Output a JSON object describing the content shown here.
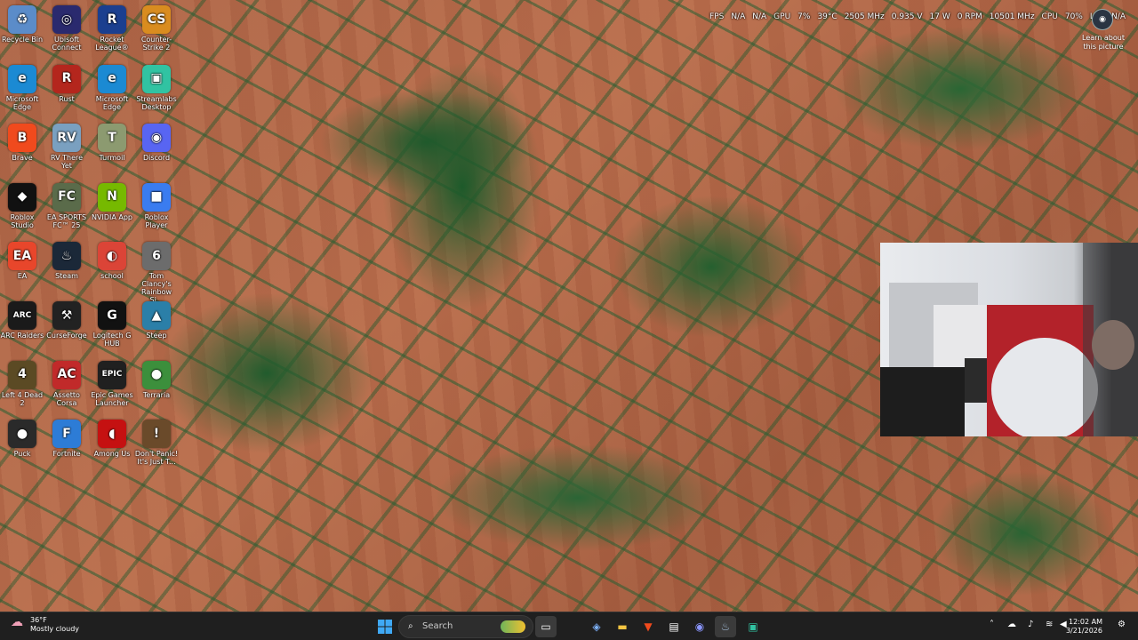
{
  "overlay": {
    "fps_label": "FPS",
    "fps_value": "N/A",
    "fps_value2": "N/A",
    "gpu_label": "GPU",
    "gpu_load": "7%",
    "gpu_temp": "39°C",
    "gpu_clock": "2505 MHz",
    "gpu_voltage": "0.935 V",
    "gpu_power": "17 W",
    "gpu_fan": "0 RPM",
    "gpu_mem_clock": "10501 MHz",
    "cpu_label": "CPU",
    "cpu_load": "70%",
    "lat_label": "LAT",
    "lat_value": "N/A"
  },
  "learn_more": "Learn about this picture",
  "desktop_icons": [
    {
      "label": "Recycle Bin",
      "icon": "recycle-bin-icon",
      "glyph": "♻",
      "color": "#5b8cc9"
    },
    {
      "label": "Ubisoft Connect",
      "icon": "ubisoft-icon",
      "glyph": "◎",
      "color": "#2a2a6e"
    },
    {
      "label": "Rocket League®",
      "icon": "rocket-league-icon",
      "glyph": "R",
      "color": "#1b3f8f"
    },
    {
      "label": "Counter-Strike 2",
      "icon": "counter-strike-icon",
      "glyph": "CS",
      "color": "#d98c1f"
    },
    {
      "label": "Microsoft Edge",
      "icon": "edge-icon",
      "glyph": "e",
      "color": "#1b8ad3"
    },
    {
      "label": "Rust",
      "icon": "rust-icon",
      "glyph": "R",
      "color": "#b4261d"
    },
    {
      "label": "Microsoft Edge",
      "icon": "edge-icon",
      "glyph": "e",
      "color": "#1b8ad3"
    },
    {
      "label": "Streamlabs Desktop",
      "icon": "streamlabs-icon",
      "glyph": "▣",
      "color": "#31c3a2"
    },
    {
      "label": "Brave",
      "icon": "brave-icon",
      "glyph": "B",
      "color": "#f04a1d"
    },
    {
      "label": "RV There Yet",
      "icon": "rv-there-yet-icon",
      "glyph": "RV",
      "color": "#7aa0c0"
    },
    {
      "label": "Turmoil",
      "icon": "turmoil-icon",
      "glyph": "T",
      "color": "#8c9a70"
    },
    {
      "label": "Discord",
      "icon": "discord-icon",
      "glyph": "◉",
      "color": "#5865f2"
    },
    {
      "label": "Roblox Studio",
      "icon": "roblox-studio-icon",
      "glyph": "◆",
      "color": "#111111"
    },
    {
      "label": "EA SPORTS FC™ 25",
      "icon": "ea-fc-icon",
      "glyph": "FC",
      "color": "#5a6b4a"
    },
    {
      "label": "NVIDIA App",
      "icon": "nvidia-icon",
      "glyph": "N",
      "color": "#76b900"
    },
    {
      "label": "Roblox Player",
      "icon": "roblox-player-icon",
      "glyph": "■",
      "color": "#3a7cf0"
    },
    {
      "label": "EA",
      "icon": "ea-icon",
      "glyph": "EA",
      "color": "#e8462b"
    },
    {
      "label": "Steam",
      "icon": "steam-icon",
      "glyph": "♨",
      "color": "#1b2838"
    },
    {
      "label": "school",
      "icon": "chrome-icon",
      "glyph": "◐",
      "color": "#db4437"
    },
    {
      "label": "Tom Clancy's Rainbow Si...",
      "icon": "rainbow-six-icon",
      "glyph": "6",
      "color": "#6c6c6c"
    },
    {
      "label": "ARC Raiders",
      "icon": "arc-raiders-icon",
      "glyph": "ARC",
      "color": "#1a1a1a"
    },
    {
      "label": "CurseForge",
      "icon": "curseforge-icon",
      "glyph": "⚒",
      "color": "#222222"
    },
    {
      "label": "Logitech G HUB",
      "icon": "logitech-icon",
      "glyph": "G",
      "color": "#111111"
    },
    {
      "label": "Steep",
      "icon": "steep-icon",
      "glyph": "▲",
      "color": "#2b7fa8"
    },
    {
      "label": "Left 4 Dead 2",
      "icon": "left4dead-icon",
      "glyph": "4",
      "color": "#5b4a24"
    },
    {
      "label": "Assetto Corsa",
      "icon": "assetto-corsa-icon",
      "glyph": "AC",
      "color": "#c12a2a"
    },
    {
      "label": "Epic Games Launcher",
      "icon": "epic-games-icon",
      "glyph": "EPIC",
      "color": "#202020"
    },
    {
      "label": "Terraria",
      "icon": "terraria-icon",
      "glyph": "●",
      "color": "#3c8f3c"
    },
    {
      "label": "Puck",
      "icon": "puck-icon",
      "glyph": "●",
      "color": "#2a2a2a"
    },
    {
      "label": "Fortnite",
      "icon": "fortnite-icon",
      "glyph": "F",
      "color": "#2d7cd6"
    },
    {
      "label": "Among Us",
      "icon": "among-us-icon",
      "glyph": "◖",
      "color": "#c51111"
    },
    {
      "label": "Don't Panic! It's Just T...",
      "icon": "dont-panic-icon",
      "glyph": "!",
      "color": "#6a4a2a"
    }
  ],
  "taskbar": {
    "search_placeholder": "Search",
    "weather_temp": "36°F",
    "weather_desc": "Mostly cloudy",
    "time": "12:02 AM",
    "date": "3/21/2026"
  }
}
